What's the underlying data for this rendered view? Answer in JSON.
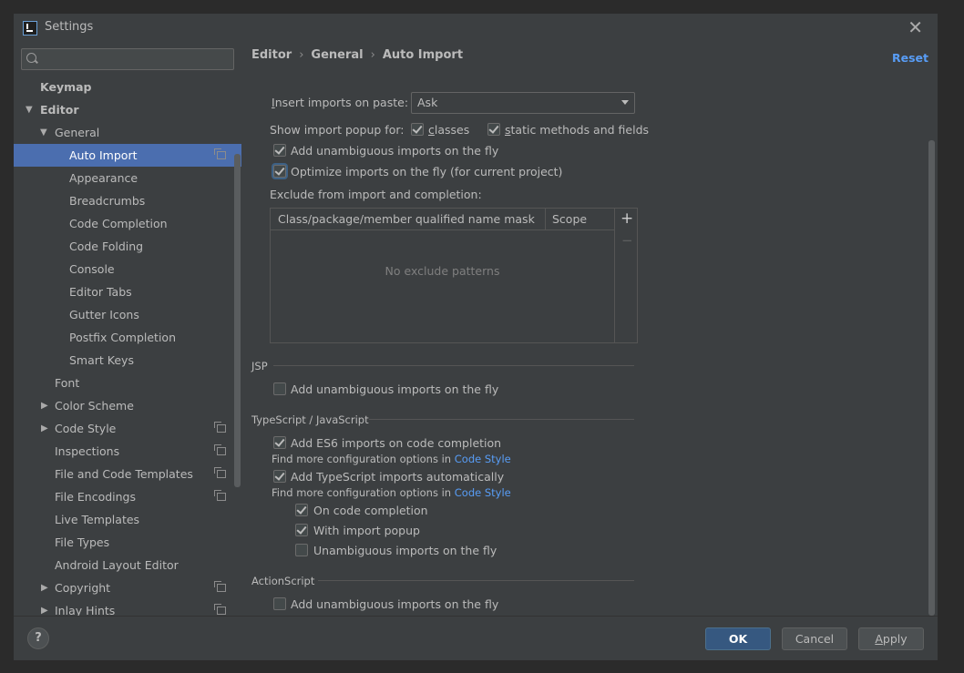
{
  "window": {
    "title": "Settings",
    "close": "✕"
  },
  "search": {
    "placeholder": ""
  },
  "sidebar": {
    "items": [
      {
        "label": "Keymap"
      },
      {
        "label": "Editor"
      },
      {
        "label": "General"
      },
      {
        "label": "Auto Import"
      },
      {
        "label": "Appearance"
      },
      {
        "label": "Breadcrumbs"
      },
      {
        "label": "Code Completion"
      },
      {
        "label": "Code Folding"
      },
      {
        "label": "Console"
      },
      {
        "label": "Editor Tabs"
      },
      {
        "label": "Gutter Icons"
      },
      {
        "label": "Postfix Completion"
      },
      {
        "label": "Smart Keys"
      },
      {
        "label": "Font"
      },
      {
        "label": "Color Scheme"
      },
      {
        "label": "Code Style"
      },
      {
        "label": "Inspections"
      },
      {
        "label": "File and Code Templates"
      },
      {
        "label": "File Encodings"
      },
      {
        "label": "Live Templates"
      },
      {
        "label": "File Types"
      },
      {
        "label": "Android Layout Editor"
      },
      {
        "label": "Copyright"
      },
      {
        "label": "Inlay Hints"
      }
    ]
  },
  "breadcrumb": {
    "items": [
      "Editor",
      "General",
      "Auto Import"
    ],
    "separator": "›"
  },
  "reset_label": "Reset",
  "java": {
    "insert_label_rest": "nsert imports on paste:",
    "insert_label_first": "I",
    "insert_value": "Ask",
    "popup_label": "Show import popup for:",
    "classes_rest": "lasses",
    "classes_first": "c",
    "static_rest": "tatic methods and fields",
    "static_first": "s",
    "add_unambiguous": "Add unambiguous imports on the fly",
    "optimize": "Optimize imports on the fly (for current project)",
    "exclude_label": "Exclude from import and completion:",
    "table": {
      "col1": "Class/package/member qualified name mask",
      "col2": "Scope",
      "empty": "No exclude patterns",
      "add": "+",
      "remove": "−"
    }
  },
  "jsp": {
    "title": "JSP",
    "add_unambiguous": "Add unambiguous imports on the fly"
  },
  "ts": {
    "title": "TypeScript / JavaScript",
    "es6": "Add ES6 imports on code completion",
    "find_more": "Find more configuration options in",
    "code_style": "Code Style",
    "ts_auto": "Add TypeScript imports automatically",
    "on_completion": "On code completion",
    "with_popup": "With import popup",
    "unambiguous": "Unambiguous imports on the fly"
  },
  "actionscript": {
    "title": "ActionScript",
    "add_unambiguous": "Add unambiguous imports on the fly"
  },
  "footer": {
    "help": "?",
    "ok": "OK",
    "cancel": "Cancel",
    "apply_first": "A",
    "apply_rest": "pply"
  }
}
